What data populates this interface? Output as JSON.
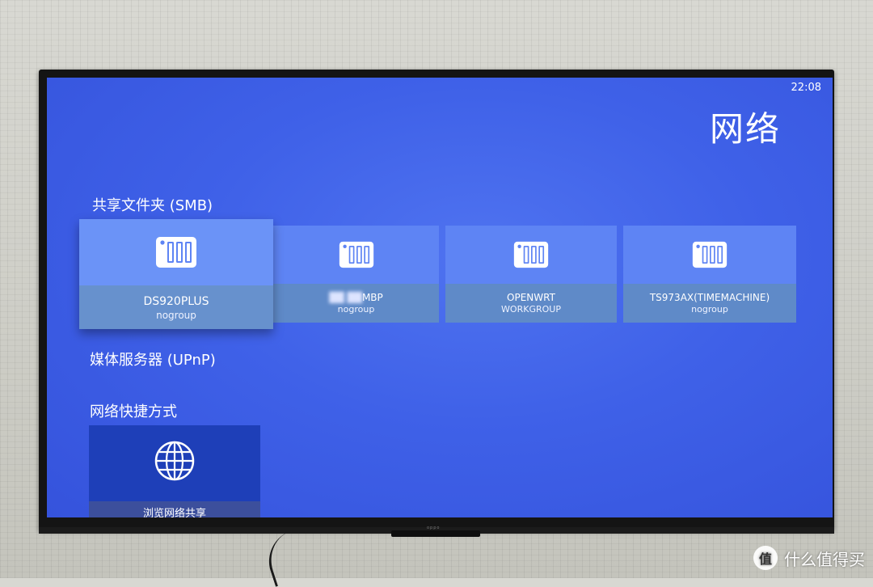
{
  "status": {
    "time": "22:08"
  },
  "page": {
    "title": "网络"
  },
  "sections": {
    "smb": "共享文件夹 (SMB)",
    "upnp": "媒体服务器 (UPnP)",
    "shortcuts": "网络快捷方式"
  },
  "smb_shares": [
    {
      "name": "DS920PLUS",
      "group": "nogroup",
      "icon": "nas-drive-icon",
      "focused": true
    },
    {
      "name_hidden": "██ ██",
      "name": "MBP",
      "group": "nogroup",
      "icon": "nas-drive-icon"
    },
    {
      "name": "OPENWRT",
      "group": "WORKGROUP",
      "icon": "nas-drive-icon"
    },
    {
      "name": "TS973AX(TIMEMACHINE)",
      "group": "nogroup",
      "icon": "nas-drive-icon"
    }
  ],
  "shortcut": {
    "label": "浏览网络共享",
    "icon": "globe-icon"
  },
  "tv": {
    "brand": "oppo"
  },
  "watermark": {
    "text": "什么值得买",
    "icon_text": "值"
  }
}
